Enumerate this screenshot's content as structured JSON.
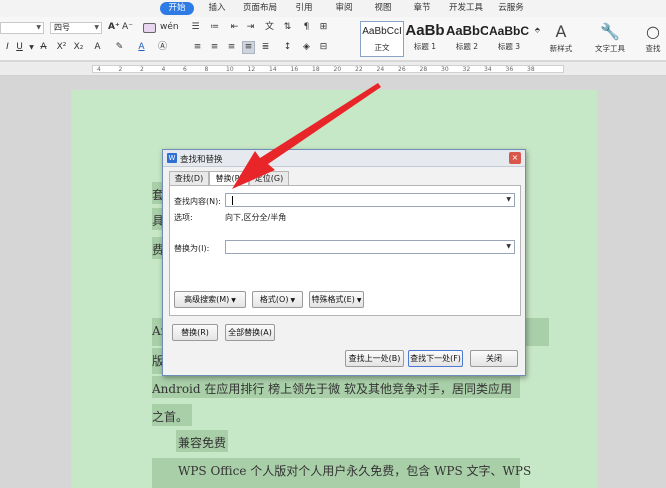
{
  "tabs": [
    {
      "label": "开始",
      "active": true
    },
    {
      "label": "插入",
      "active": false
    },
    {
      "label": "页面布局",
      "active": false
    },
    {
      "label": "引用",
      "active": false
    },
    {
      "label": "审阅",
      "active": false
    },
    {
      "label": "视图",
      "active": false
    },
    {
      "label": "章节",
      "active": false
    },
    {
      "label": "开发工具",
      "active": false
    },
    {
      "label": "云服务",
      "active": false
    }
  ],
  "ribbon": {
    "font_size": "四号",
    "styles": [
      {
        "preview": "AaBbCcI",
        "name": "正文"
      },
      {
        "preview": "AaBb",
        "name": "标题 1"
      },
      {
        "preview": "AaBbC",
        "name": "标题 2"
      },
      {
        "preview": "AaBbC",
        "name": "标题 3"
      }
    ],
    "new_style": "新样式",
    "text_tools": "文字工具",
    "find": "查找"
  },
  "ruler": {
    "ticks": [
      "4",
      "2",
      "2",
      "4",
      "6",
      "8",
      "10",
      "12",
      "14",
      "16",
      "18",
      "20",
      "22",
      "24",
      "26",
      "28",
      "30",
      "32",
      "34",
      "36",
      "38"
    ]
  },
  "document": {
    "frag_1": "套",
    "frag_2": "具",
    "frag_3": "费",
    "frag_4": "（",
    "frag_5": "An",
    "frag_6": "版",
    "line_android": "Android 在应用排行 榜上领先于微 软及其他竞争对手，居同类应用",
    "line_top": "之首。",
    "line_compat": "兼容免费",
    "line_wps": "WPS Office 个人版对个人用户永久免费，包含 WPS 文字、WPS"
  },
  "dialog": {
    "title": "查找和替换",
    "app_icon": "W",
    "close": "×",
    "tabs": [
      "查找(D)",
      "替换(P)",
      "定位(G)"
    ],
    "find_label": "查找内容(N):",
    "find_value": "",
    "options_label": "选项:",
    "options_value": "向下,区分全/半角",
    "replace_label": "替换为(I):",
    "replace_value": "",
    "btn_advanced": "高级搜索(M)",
    "btn_format": "格式(O)",
    "btn_special": "特殊格式(E)",
    "btn_replace": "替换(R)",
    "btn_replace_all": "全部替换(A)",
    "btn_find_prev": "查找上一处(B)",
    "btn_find_next": "查找下一处(F)",
    "btn_close": "关闭"
  },
  "colors": {
    "accent": "#2e7be6",
    "doc_bg": "#c7e8c6",
    "highlight": "#a9cfa9",
    "arrow": "#e8262a"
  }
}
